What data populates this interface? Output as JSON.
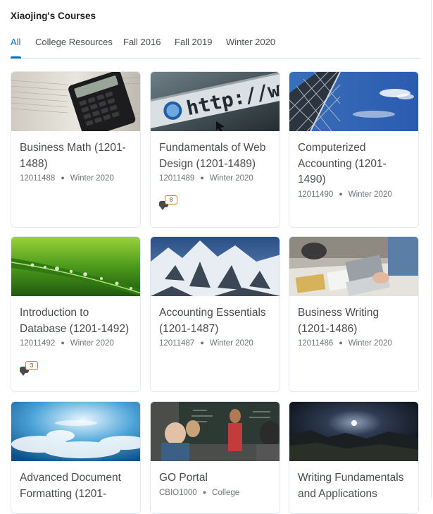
{
  "widget": {
    "title": "Xiaojing's Courses"
  },
  "tabs": [
    {
      "label": "All"
    },
    {
      "label": "College Resources"
    },
    {
      "label": "Fall 2016"
    },
    {
      "label": "Fall 2019"
    },
    {
      "label": "Winter 2020"
    }
  ],
  "courses": [
    {
      "title": "Business Math (1201-1488)",
      "code": "12011488",
      "term": "Winter 2020"
    },
    {
      "title": "Fundamentals of Web Design (1201-1489)",
      "code": "12011489",
      "term": "Winter 2020",
      "notifications": "8"
    },
    {
      "title": "Computerized Accounting (1201-1490)",
      "code": "12011490",
      "term": "Winter 2020"
    },
    {
      "title": "Introduction to Database (1201-1492)",
      "code": "12011492",
      "term": "Winter 2020",
      "notifications": "3"
    },
    {
      "title": "Accounting Essentials (1201-1487)",
      "code": "12011487",
      "term": "Winter 2020"
    },
    {
      "title": "Business Writing (1201-1486)",
      "code": "12011486",
      "term": "Winter 2020"
    },
    {
      "title": "Advanced Document Formatting (1201-",
      "code": "",
      "term": ""
    },
    {
      "title": "GO Portal",
      "code": "CBIO1000",
      "term": "College"
    },
    {
      "title": "Writing Fundamentals and Applications",
      "code": "",
      "term": ""
    }
  ],
  "image_icons": [
    "calculator-on-book-image",
    "http-address-bar-image",
    "steel-tower-sky-image",
    "grass-dewdrops-image",
    "snowy-mountains-image",
    "laptop-desk-meeting-image",
    "clouds-sky-image",
    "classroom-presentation-image",
    "night-sky-landscape-image"
  ],
  "colors": {
    "accent": "#006fbf",
    "notification_border": "#e87511",
    "text": "#494c4e",
    "meta": "#6e7376"
  }
}
